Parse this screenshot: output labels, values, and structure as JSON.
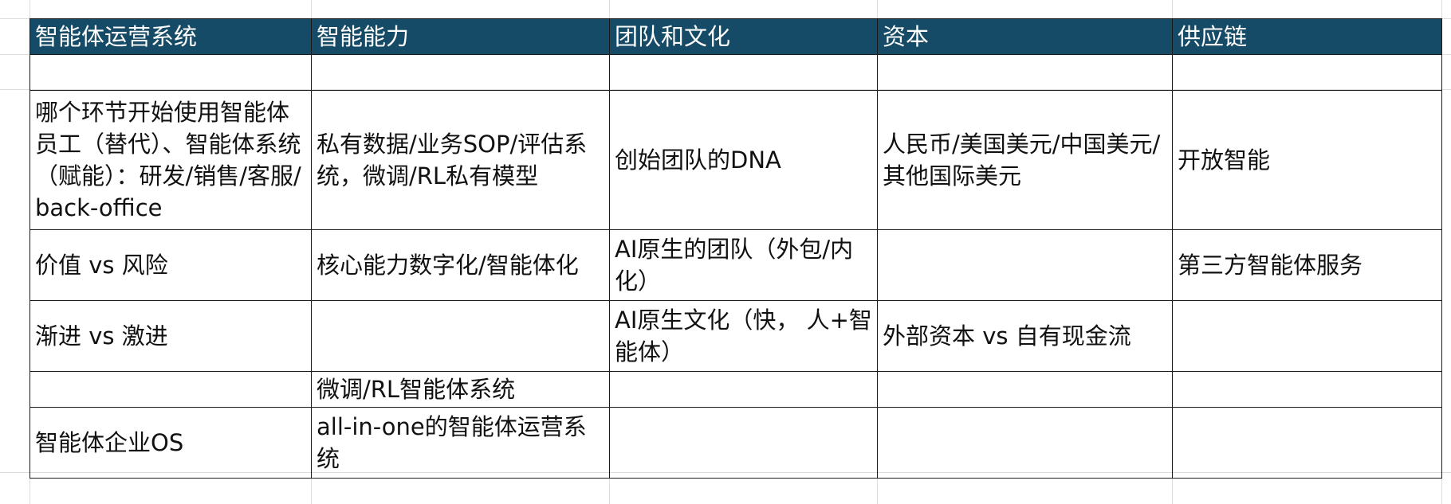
{
  "table": {
    "headers": [
      "智能体运营系统",
      "智能能力",
      "团队和文化",
      "资本",
      "供应链"
    ],
    "rows": [
      [
        "",
        "",
        "",
        "",
        ""
      ],
      [
        "哪个环节开始使用智能体员工（替代）、智能体系统（赋能）：研发/销售/客服/back-office",
        "私有数据/业务SOP/评估系统，微调/RL私有模型",
        "创始团队的DNA",
        "人民币/美国美元/中国美元/其他国际美元",
        "开放智能"
      ],
      [
        "价值 vs 风险",
        "核心能力数字化/智能体化",
        "AI原生的团队（外包/内化）",
        "",
        "第三方智能体服务"
      ],
      [
        "渐进 vs 激进",
        "",
        "AI原生文化（快， 人+智能体）",
        "外部资本 vs 自有现金流",
        ""
      ],
      [
        "",
        "微调/RL智能体系统",
        "",
        "",
        ""
      ],
      [
        "智能体企业OS",
        "all-in-one的智能体运营系统",
        "",
        "",
        ""
      ]
    ]
  },
  "colors": {
    "header_bg": "#154b66",
    "header_text": "#ffffff",
    "border": "#1a1a1a",
    "gridline": "#dcdcdc"
  }
}
